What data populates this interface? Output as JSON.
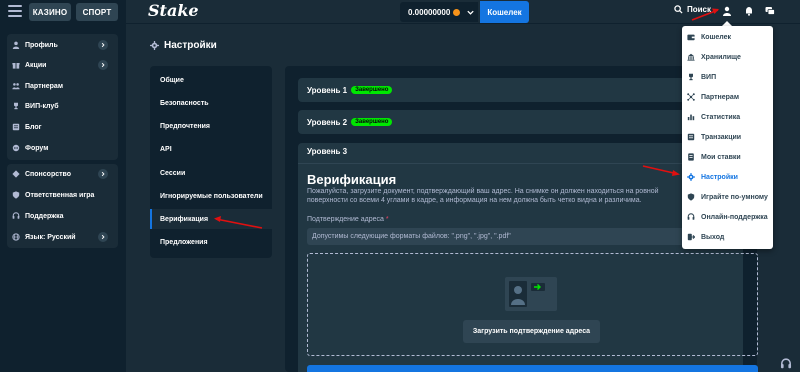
{
  "header": {
    "casino_label": "КАЗИНО",
    "sport_label": "СПОРТ",
    "logo_text": "Stake",
    "balance": "0.00000000",
    "wallet_label": "Кошелек",
    "search_label": "Поиск"
  },
  "sidebar": {
    "group1": [
      {
        "label": "Профиль",
        "icon": "user-icon",
        "chevron": true
      },
      {
        "label": "Акции",
        "icon": "gift-icon",
        "chevron": true
      },
      {
        "label": "Партнерам",
        "icon": "handshake-icon",
        "chevron": false
      },
      {
        "label": "ВИП-клуб",
        "icon": "trophy-icon",
        "chevron": false
      },
      {
        "label": "Блог",
        "icon": "blog-icon",
        "chevron": false
      },
      {
        "label": "Форум",
        "icon": "forum-icon",
        "chevron": false
      }
    ],
    "group2": [
      {
        "label": "Спонсорство",
        "icon": "sponsor-icon",
        "chevron": true
      },
      {
        "label": "Ответственная игра",
        "icon": "shield-icon",
        "chevron": false
      },
      {
        "label": "Поддержка",
        "icon": "headset-icon",
        "chevron": false
      },
      {
        "label": "Язык: Русский",
        "icon": "globe-icon",
        "chevron": true
      }
    ]
  },
  "page": {
    "title": "Настройки",
    "nav": [
      "Общие",
      "Безопасность",
      "Предпочтения",
      "API",
      "Сессии",
      "Игнорируемые пользователи",
      "Верификация",
      "Предложения"
    ],
    "active_nav": "Верификация"
  },
  "levels": {
    "level1_label": "Уровень 1",
    "level1_badge": "Завершено",
    "level2_label": "Уровень 2",
    "level2_badge": "Завершено",
    "level3_label": "Уровень 3"
  },
  "verification": {
    "title": "Верификация",
    "description": "Пожалуйста, загрузите документ, подтверждающий ваш адрес. На снимке он должен находиться на ровной поверхности со всеми 4 углами в кадре, а информация на нем должна быть четко видна и различима.",
    "address_label": "Подтверждение адреса",
    "required_mark": "*",
    "formats_text": "Допустимы следующие форматы файлов: \".png\", \".jpg\", \".pdf\"",
    "upload_label": "Загрузить подтверждение адреса"
  },
  "user_menu": {
    "items": [
      {
        "label": "Кошелек",
        "icon": "wallet-icon"
      },
      {
        "label": "Хранилище",
        "icon": "vault-icon"
      },
      {
        "label": "ВИП",
        "icon": "trophy-icon"
      },
      {
        "label": "Партнерам",
        "icon": "affiliate-icon"
      },
      {
        "label": "Статистика",
        "icon": "stats-icon"
      },
      {
        "label": "Транзакции",
        "icon": "transactions-icon"
      },
      {
        "label": "Мои ставки",
        "icon": "bets-icon"
      },
      {
        "label": "Настройки",
        "icon": "gear-icon"
      },
      {
        "label": "Играйте по-умному",
        "icon": "shield-icon"
      },
      {
        "label": "Онлайн-поддержка",
        "icon": "headset-icon"
      },
      {
        "label": "Выход",
        "icon": "logout-icon"
      }
    ],
    "active": "Настройки"
  },
  "colors": {
    "background": "#1a2c38",
    "panel": "#0f212e",
    "accent": "#1475e1",
    "success_badge": "#00e701",
    "annotation_arrow": "#e01010"
  }
}
